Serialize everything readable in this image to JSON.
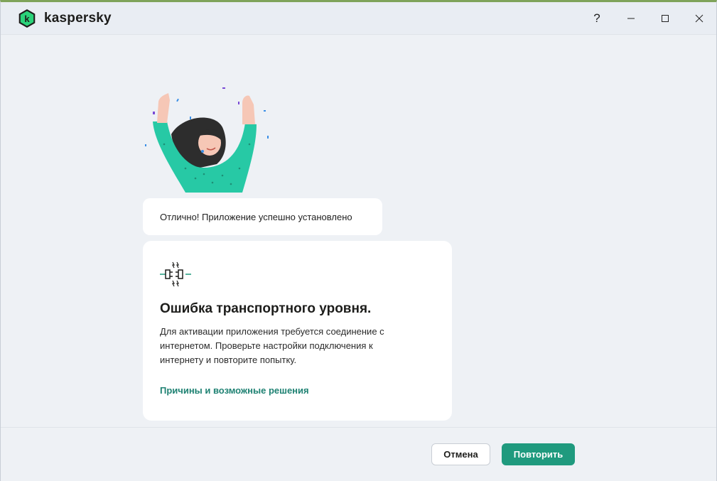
{
  "app": {
    "brand_name": "kaspersky",
    "colors": {
      "accent": "#1f9a7e",
      "link": "#1f8273",
      "logo_green": "#2bd37a"
    }
  },
  "window_controls": {
    "help_label": "?",
    "icons": [
      "help-icon",
      "minimize-icon",
      "maximize-icon",
      "close-icon"
    ]
  },
  "success_message": "Отлично! Приложение успешно установлено",
  "error_card": {
    "icon": "disconnected-plug-icon",
    "title": "Ошибка транспортного уровня.",
    "text": "Для активации приложения требуется соединение с интернетом. Проверьте настройки подключения к интернету и повторите попытку.",
    "link": "Причины и возможные решения"
  },
  "footer": {
    "cancel_label": "Отмена",
    "retry_label": "Повторить"
  }
}
